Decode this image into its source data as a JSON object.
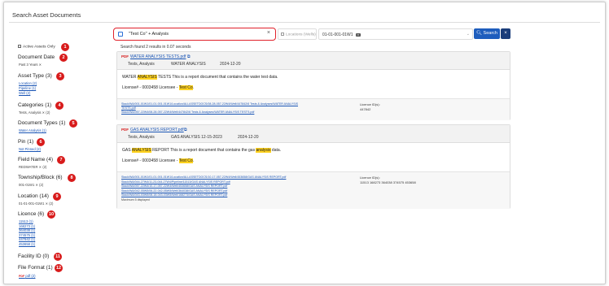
{
  "page_title": "Search Asset Documents",
  "search": {
    "query": "\"Test Co\" + Analysis",
    "location_placeholder": "Locations (Wells)",
    "location_value": "01-01-001-01W1",
    "search_label": "Search",
    "clear_label": "×"
  },
  "filters": {
    "active_only": "Active Assets Only",
    "document_date": {
      "title": "Document Date",
      "badge": "2",
      "selected": "Past 3 Years ✕"
    },
    "asset_type": {
      "title": "Asset Type (3)",
      "badge": "3",
      "items": [
        "Location (2)",
        "Pipeline (1)",
        "Well (2)"
      ]
    },
    "categories": {
      "title": "Categories (1)",
      "badge": "4",
      "selected": "Tests, Analysis ✕ (2)"
    },
    "document_types": {
      "title": "Document Types (1)",
      "badge": "5",
      "items": [
        "Water Analysis (1)"
      ]
    },
    "pin": {
      "title": "Pin (1)",
      "badge": "6",
      "items": [
        "Not Pinned (2)"
      ]
    },
    "field_name": {
      "title": "Field Name (4)",
      "badge": "7",
      "selected": "REDWATER ✕ (2)"
    },
    "township_block": {
      "title": "Township/Block (6)",
      "badge": "8",
      "selected": "001-01W1 ✕ (2)"
    },
    "location": {
      "title": "Location (14)",
      "badge": "9",
      "selected": "01-01-001-01W1 ✕ (2)"
    },
    "licence": {
      "title": "Licence (6)",
      "badge": "10",
      "items": [
        "11513 (1)",
        "168273 (1)",
        "364038 (1)",
        "374575 (1)",
        "447842 (1)",
        "453658 (1)"
      ]
    },
    "facility_id": {
      "title": "Facility ID (0)",
      "badge": "11"
    },
    "file_format": {
      "title": "File Format (1)",
      "badge": "12",
      "items": [
        "pdf (2)"
      ]
    },
    "active_badge": "1"
  },
  "results": {
    "summary": "Search found 2 results in 0.07 seconds",
    "items": [
      {
        "icon": "PDF",
        "file": "WATER ANALYSIS TESTS.pdf",
        "meta_category": "Tests, Analysis",
        "meta_type": "WATER ANALYSIS",
        "meta_date": "2024-12-20",
        "desc_pre": "WATER ",
        "desc_hl": "ANALYSIS",
        "desc_post": " TESTS This is a report document that contains the water test data.",
        "lic_pre": "License# - 0003458 Licensee - ",
        "lic_hl": "Test Co",
        "lic_post": ".",
        "paths": [
          "Stack/WA/001-01W1/01-01-001-01W1/Location/ALLASSETDOCS/08-28-057-22W4/Well/447842/6 Tests & Analyses/WATER ANALYSIS",
          "TESTS.pdf",
          "Stack/WA/057-22W4/08-28-057-22W4/Well/447842/6 Tests & Analyses/WATER ANALYSIS TESTS.pdf"
        ],
        "licence_label": "Licence ID(s):",
        "licence_values": "447842"
      },
      {
        "icon": "PDF",
        "file": "GAS ANALYSIS REPORT.pdf",
        "meta_category": "Tests, Analysis",
        "meta_type": "GAS ANALYSIS 12-15-2023",
        "meta_date": "2024-12-20",
        "desc_pre": "GAS ",
        "desc_hl": "ANALYSIS",
        "desc_mid": " REPORT This is a report document that contains the gas ",
        "desc_hl2": "analysis",
        "desc_post": " data.",
        "lic_pre": "License# - 0003458 Licensee - ",
        "lic_hl": "Test Co",
        "lic_post": ".",
        "paths": [
          "Stack/WA/001-01W1/01-01-001-01W1/Location/ALLASSETDOCS/10-17-057-22W4/Well/453658/GAS ANALYSIS REPORT.pdf",
          "Stack/WA/044-27W4/11-23-044-27W4/Pipeline/11513/GAS ANALYSIS REPORT.pdf",
          "Stack/WA/057-22W4/10-17-057-22W4/Well/453658/GAS ANALYSIS REPORT.pdf",
          "Stack/WA/042-05W5/06-22-042-05W5/Well/364038/GAS ANALYSIS REPORT.pdf",
          "Stack/WA/043-03W5/08-18-043-03W5/Well/168273/GAS ANALYSIS REPORT.pdf"
        ],
        "more_note": "Maximum 5 displayed",
        "licence_label": "Licence ID(s):",
        "licence_values": "11513  168273  364038  374575  453658"
      }
    ]
  },
  "colors": {
    "accent": "#1e5dbd",
    "badge": "#d81b1b",
    "highlight": "#ffd21f",
    "red_border": "#e0202a"
  }
}
